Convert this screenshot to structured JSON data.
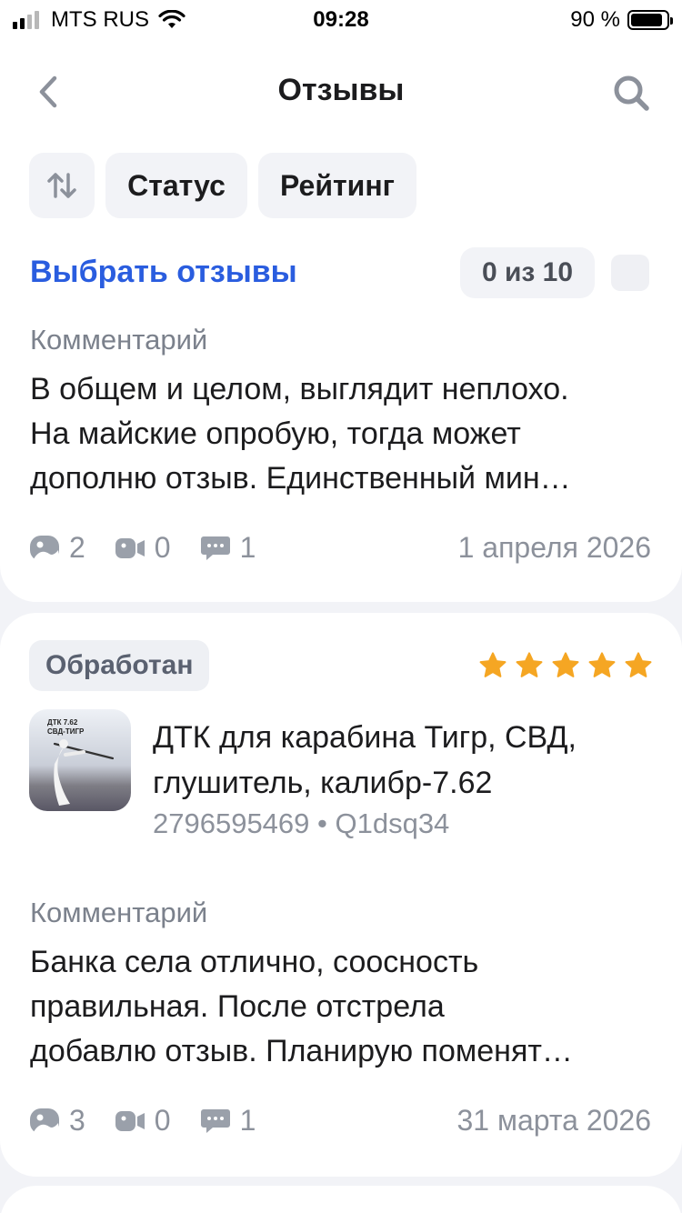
{
  "status_bar": {
    "carrier": "MTS RUS",
    "time": "09:28",
    "battery": "90 %",
    "battery_level": 0.9
  },
  "nav": {
    "title": "Отзывы",
    "back_icon": "chevron-left-icon",
    "search_icon": "search-icon"
  },
  "filters": {
    "sort_icon": "sort-arrows-icon",
    "status_label": "Статус",
    "rating_label": "Рейтинг"
  },
  "selection": {
    "link_label": "Выбрать отзывы",
    "counter": "0 из 10"
  },
  "reviews": [
    {
      "comment_label": "Комментарий",
      "comment_lines": [
        "В общем и целом, выглядит неплохо.",
        "На майские опробую, тогда может",
        "дополню отзыв. Единственный мин…"
      ],
      "photos": "2",
      "videos": "0",
      "replies": "1",
      "date": "1 апреля 2026"
    },
    {
      "status": "Обработан",
      "rating": 5,
      "product_image_text": [
        "ДТК 7.62",
        "СВД-ТИГР"
      ],
      "product_title_lines": [
        "ДТК для карабина Тигр, СВД,",
        "глушитель, калибр-7.62"
      ],
      "product_meta": "2796595469 • Q1dsq34",
      "comment_label": "Комментарий",
      "comment_lines": [
        "Банка села отлично, соосность",
        "правильная. После отстрела",
        "добавлю отзыв. Планирую поменят…"
      ],
      "photos": "3",
      "videos": "0",
      "replies": "1",
      "date": "31 марта 2026"
    }
  ],
  "colors": {
    "accent": "#2a5ddf",
    "star": "#f5a623",
    "background": "#f2f3f7",
    "muted_text": "#8c919b"
  }
}
